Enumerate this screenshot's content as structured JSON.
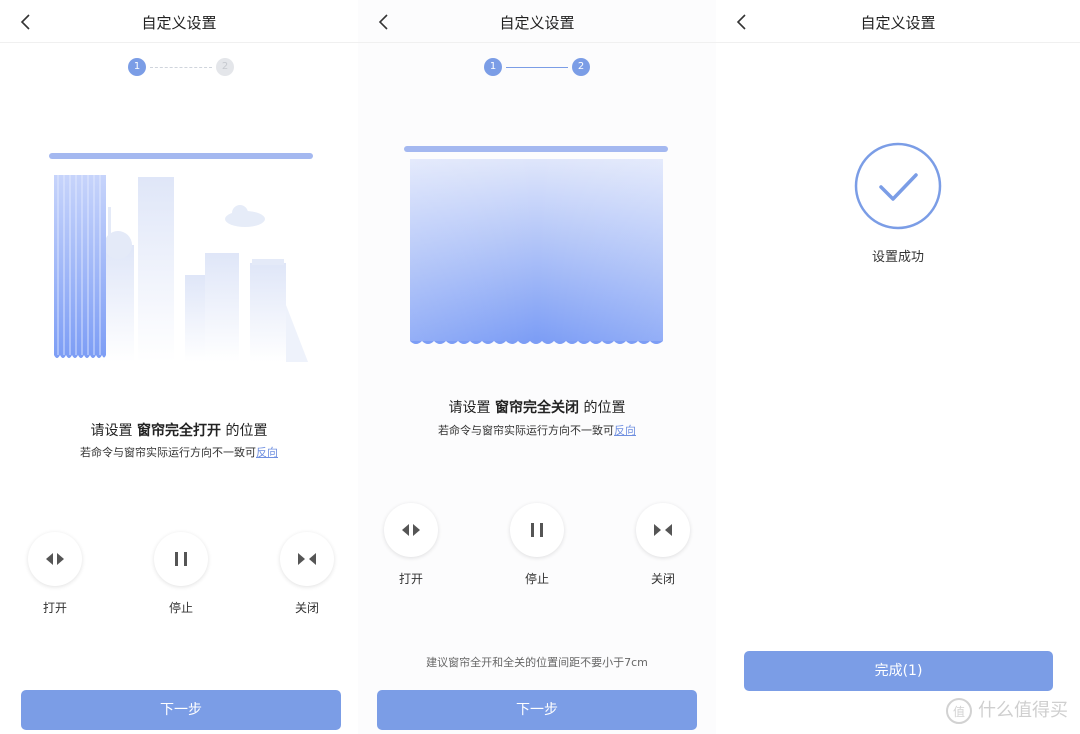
{
  "screens": [
    {
      "title": "自定义设置",
      "steps": [
        "1",
        "2"
      ],
      "active_step": 1,
      "instruction": {
        "prefix": "请设置 ",
        "emphasis": "窗帘完全打开",
        "suffix": " 的位置"
      },
      "subnote": {
        "text": "若命令与窗帘实际运行方向不一致可",
        "link": "反向"
      },
      "controls": [
        {
          "label": "打开",
          "icon": "open-arrows-icon"
        },
        {
          "label": "停止",
          "icon": "pause-icon"
        },
        {
          "label": "关闭",
          "icon": "close-arrows-icon"
        }
      ],
      "button": "下一步"
    },
    {
      "title": "自定义设置",
      "steps": [
        "1",
        "2"
      ],
      "active_step": 2,
      "instruction": {
        "prefix": "请设置 ",
        "emphasis": "窗帘完全关闭",
        "suffix": " 的位置"
      },
      "subnote": {
        "text": "若命令与窗帘实际运行方向不一致可",
        "link": "反向"
      },
      "controls": [
        {
          "label": "打开",
          "icon": "open-arrows-icon"
        },
        {
          "label": "停止",
          "icon": "pause-icon"
        },
        {
          "label": "关闭",
          "icon": "close-arrows-icon"
        }
      ],
      "hint": "建议窗帘全开和全关的位置间距不要小于7cm",
      "button": "下一步"
    },
    {
      "title": "自定义设置",
      "success_text": "设置成功",
      "button": "完成(1)"
    }
  ],
  "watermark": {
    "icon_text": "值",
    "text": "什么值得买"
  },
  "colors": {
    "accent": "#7b9de6",
    "curtain_top": "#dfe6fb",
    "curtain_bottom": "#7c9df5"
  }
}
